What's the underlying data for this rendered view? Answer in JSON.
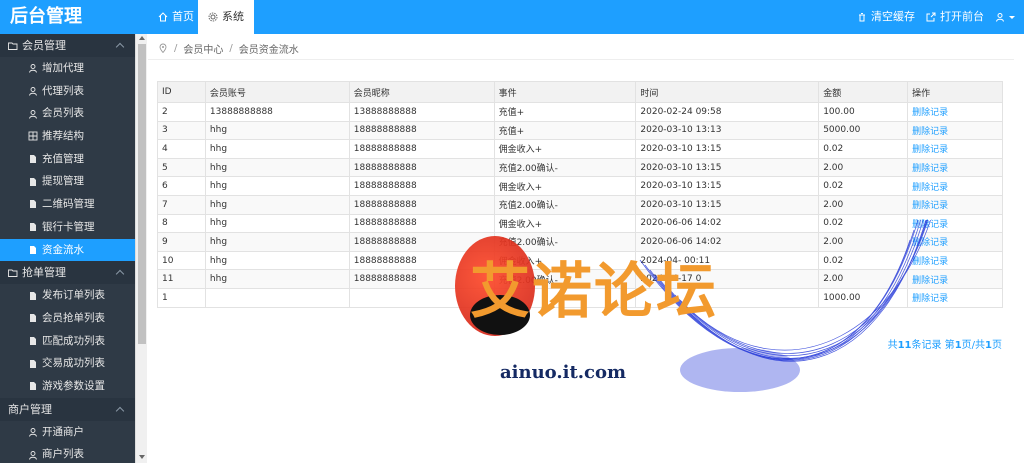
{
  "header": {
    "brand": "后台管理",
    "tabs": [
      {
        "label": "首页",
        "icon": "home-icon"
      },
      {
        "label": "系统",
        "icon": "gear-icon"
      }
    ],
    "clear_cache": "清空缓存",
    "open_front": "打开前台"
  },
  "sidebar": {
    "groups": [
      {
        "title": "会员管理",
        "expanded": true,
        "items": [
          "增加代理",
          "代理列表",
          "会员列表",
          "推荐结构",
          "充值管理",
          "提现管理",
          "二维码管理",
          "银行卡管理",
          "资金流水"
        ],
        "active": "资金流水"
      },
      {
        "title": "抢单管理",
        "expanded": true,
        "items": [
          "发布订单列表",
          "会员抢单列表",
          "匹配成功列表",
          "交易成功列表",
          "游戏参数设置"
        ]
      },
      {
        "title": "商户管理",
        "expanded": true,
        "items": [
          "开通商户",
          "商户列表"
        ]
      }
    ]
  },
  "breadcrumb": {
    "parent": "会员中心",
    "current": "会员资金流水",
    "separator": "/"
  },
  "table": {
    "headers": [
      "ID",
      "会员账号",
      "会员昵称",
      "事件",
      "时间",
      "金额",
      "操作"
    ],
    "rows": [
      [
        "2",
        "13888888888",
        "13888888888",
        "充值+",
        "2020-02-24 09:58",
        "100.00",
        "删除记录"
      ],
      [
        "3",
        "hhg",
        "18888888888",
        "充值+",
        "2020-03-10 13:13",
        "5000.00",
        "删除记录"
      ],
      [
        "4",
        "hhg",
        "18888888888",
        "佣金收入+",
        "2020-03-10 13:15",
        "0.02",
        "删除记录"
      ],
      [
        "5",
        "hhg",
        "18888888888",
        "充值2.00确认-",
        "2020-03-10 13:15",
        "2.00",
        "删除记录"
      ],
      [
        "6",
        "hhg",
        "18888888888",
        "佣金收入+",
        "2020-03-10 13:15",
        "0.02",
        "删除记录"
      ],
      [
        "7",
        "hhg",
        "18888888888",
        "充值2.00确认-",
        "2020-03-10 13:15",
        "2.00",
        "删除记录"
      ],
      [
        "8",
        "hhg",
        "18888888888",
        "佣金收入+",
        "2020-06-06 14:02",
        "0.02",
        "删除记录"
      ],
      [
        "9",
        "hhg",
        "18888888888",
        "充值2.00确认-",
        "2020-06-06 14:02",
        "2.00",
        "删除记录"
      ],
      [
        "10",
        "hhg",
        "18888888888",
        "佣金收入+",
        "2024-04-  00:11",
        "0.02",
        "删除记录"
      ],
      [
        "11",
        "hhg",
        "18888888888",
        "充值2.00确认-",
        "2024-04-17 0",
        "2.00",
        "删除记录"
      ],
      [
        "1",
        "",
        "",
        "",
        "",
        "1000.00",
        "删除记录"
      ]
    ]
  },
  "pager": {
    "prefix": "共",
    "count": "11",
    "mid": "条记录 第",
    "page": "1",
    "mid2": "页/共",
    "pages": "1",
    "suffix": "页"
  },
  "watermark": {
    "text": "艾诺论坛",
    "url": "ainuo.it.com"
  },
  "colors": {
    "accent": "#1E9FFF",
    "sidebar_bg": "#2f3a46",
    "watermark_orange": "#f29a2e"
  }
}
